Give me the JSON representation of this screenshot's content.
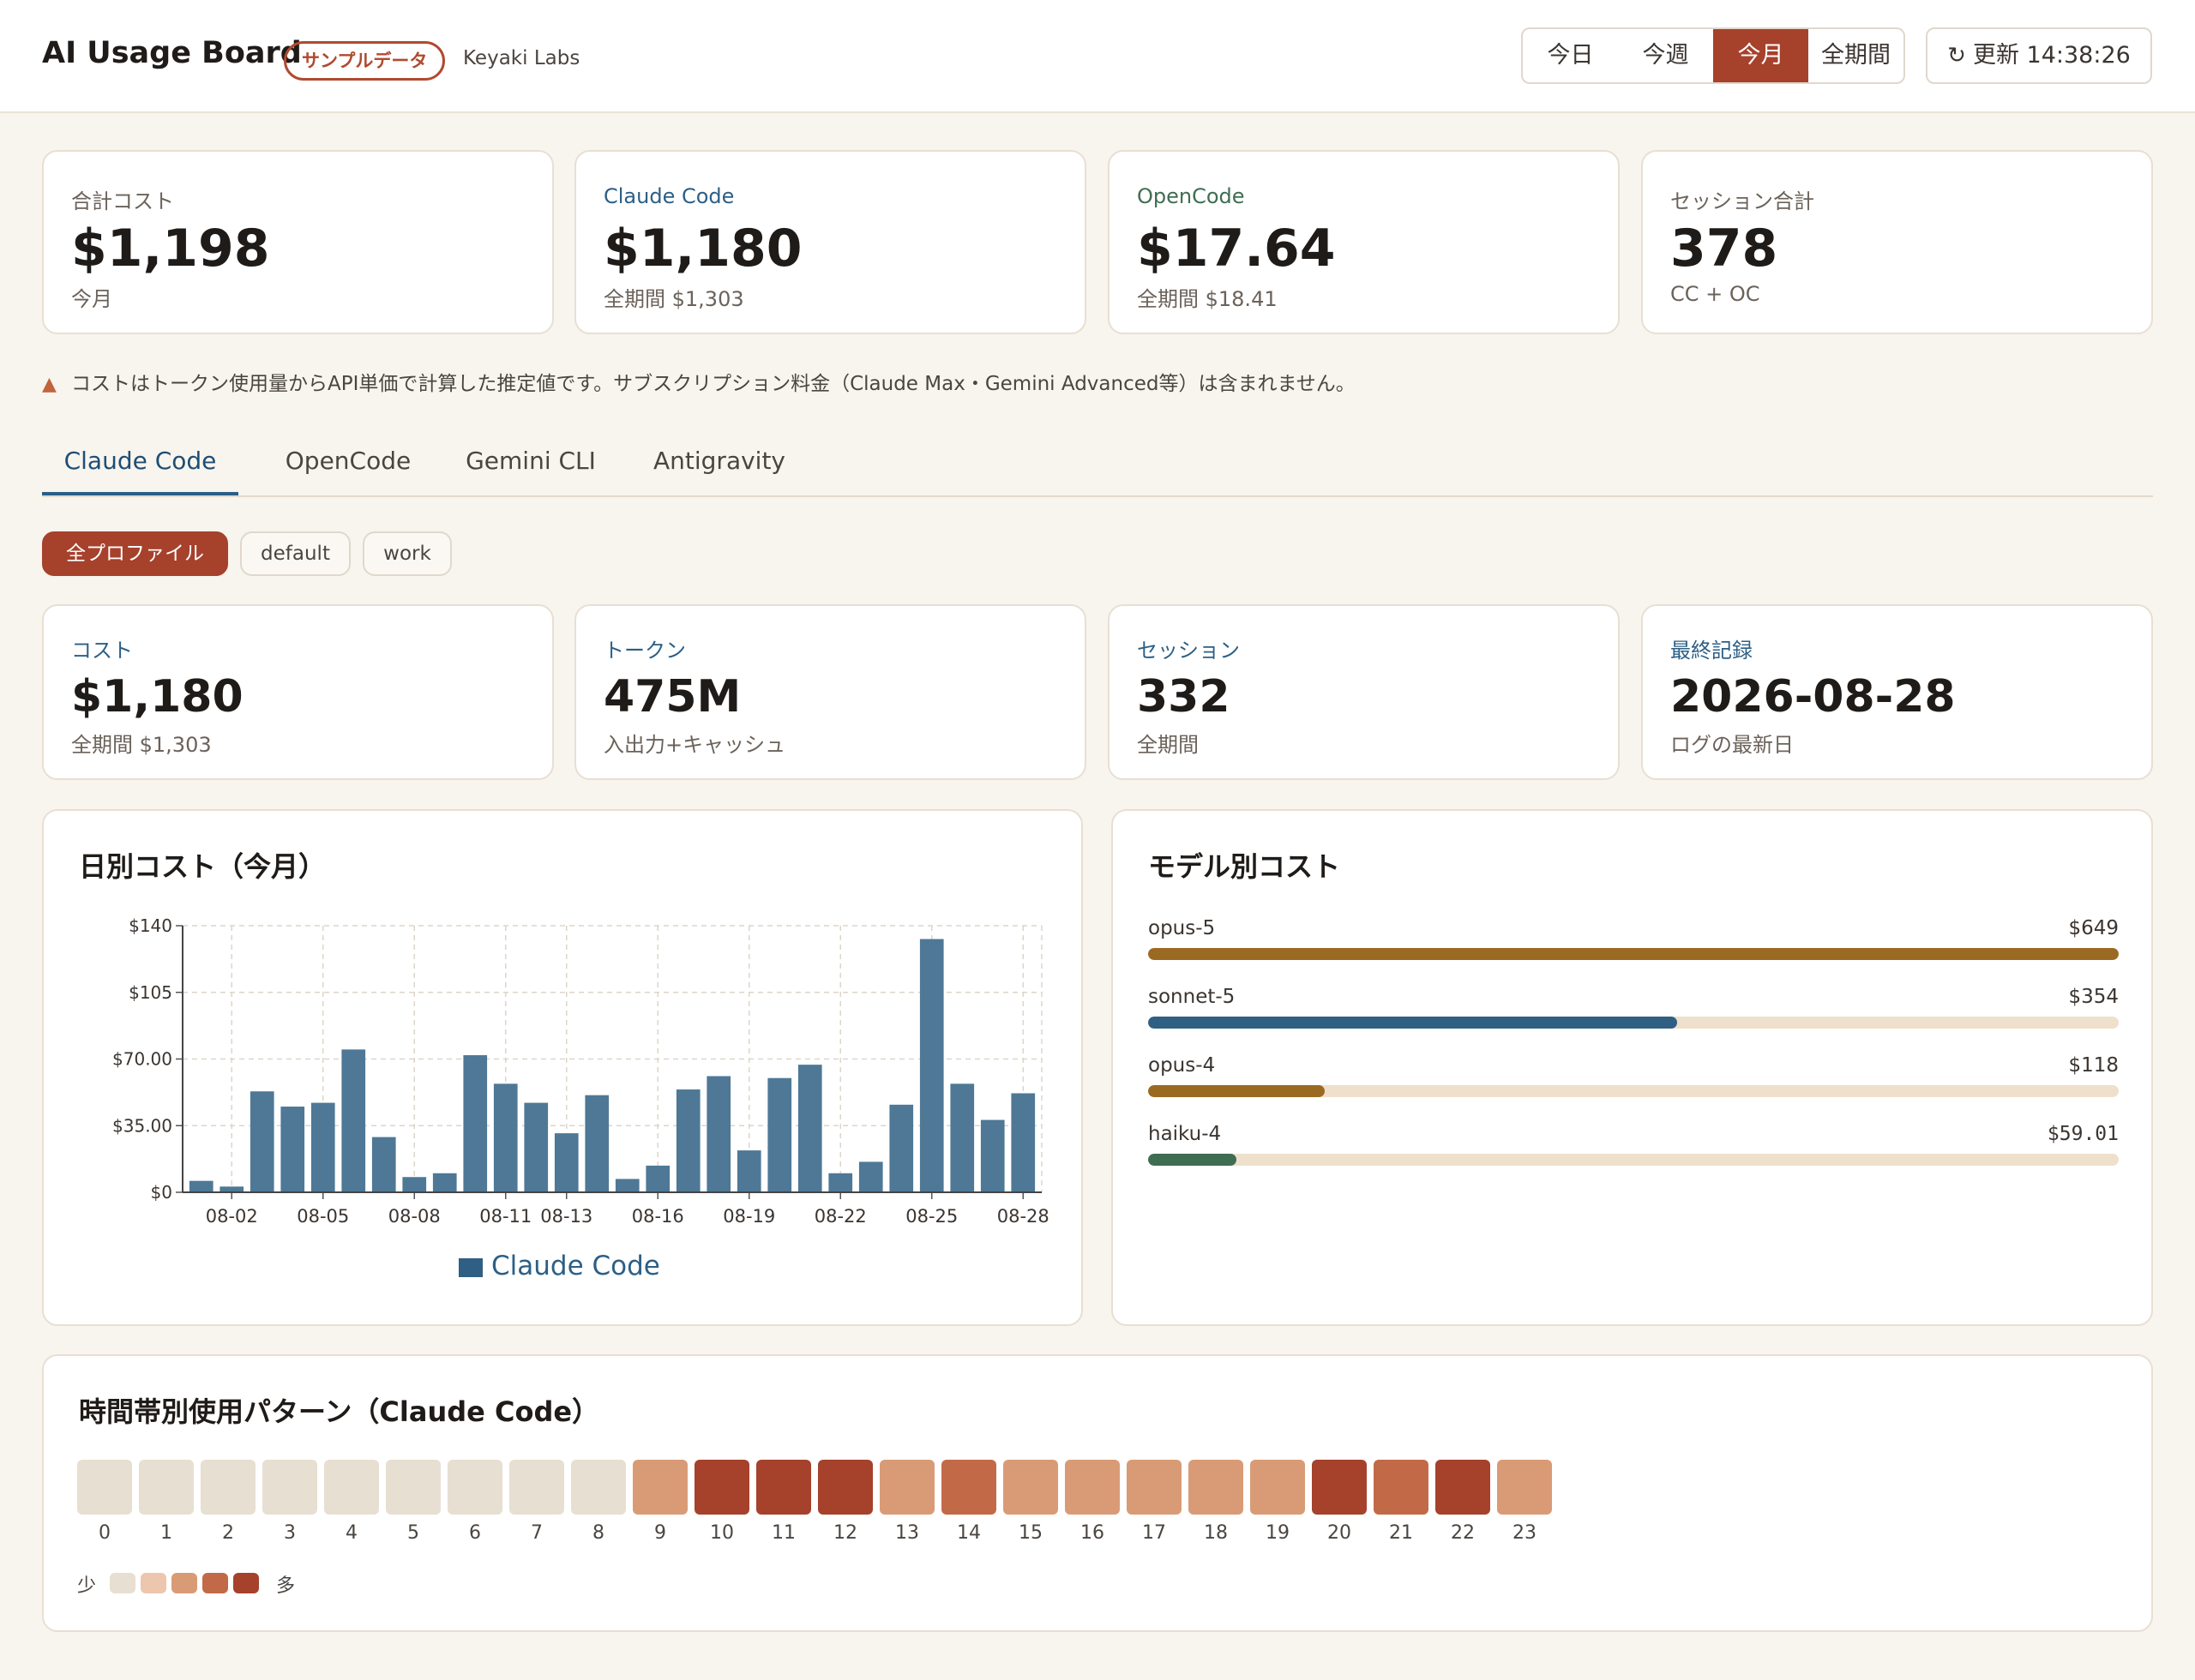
{
  "header": {
    "title": "AI Usage Board",
    "badge": "サンプルデータ",
    "org": "Keyaki Labs",
    "ranges": [
      "今日",
      "今週",
      "今月",
      "全期間"
    ],
    "active_range": "今月",
    "refresh_label": "更新 14:38:26"
  },
  "summary": [
    {
      "label": "合計コスト",
      "value": "$1,198",
      "sub": "今月"
    },
    {
      "label": "Claude Code",
      "value": "$1,180",
      "sub": "全期間 $1,303"
    },
    {
      "label": "OpenCode",
      "value": "$17.64",
      "sub": "全期間 $18.41"
    },
    {
      "label": "セッション合計",
      "value": "378",
      "sub": "CC + OC"
    }
  ],
  "notice": "コストはトークン使用量からAPI単価で計算した推定値です。サブスクリプション料金（Claude Max・Gemini Advanced等）は含まれません。",
  "tabs": [
    "Claude Code",
    "OpenCode",
    "Gemini CLI",
    "Antigravity"
  ],
  "active_tab": "Claude Code",
  "profiles": [
    "全プロファイル",
    "default",
    "work"
  ],
  "active_profile": "全プロファイル",
  "detail_stats": [
    {
      "label": "コスト",
      "value": "$1,180",
      "sub": "全期間 $1,303"
    },
    {
      "label": "トークン",
      "value": "475M",
      "sub": "入出力+キャッシュ"
    },
    {
      "label": "セッション",
      "value": "332",
      "sub": "全期間"
    },
    {
      "label": "最終記録",
      "value": "2026-08-28",
      "sub": "ログの最新日"
    }
  ],
  "daily_panel_title": "日別コスト（今月）",
  "model_panel_title": "モデル別コスト",
  "hourly_panel_title": "時間帯別使用パターン（Claude Code）",
  "chart_data": {
    "type": "bar",
    "title": "日別コスト（今月）",
    "categories": [
      "08-01",
      "08-02",
      "08-03",
      "08-04",
      "08-05",
      "08-06",
      "08-07",
      "08-08",
      "08-09",
      "08-10",
      "08-11",
      "08-12",
      "08-13",
      "08-14",
      "08-15",
      "08-16",
      "08-17",
      "08-18",
      "08-19",
      "08-20",
      "08-21",
      "08-22",
      "08-23",
      "08-24",
      "08-25",
      "08-26",
      "08-27",
      "08-28"
    ],
    "tick_labels": [
      "08-02",
      "08-05",
      "08-08",
      "08-11",
      "08-13",
      "08-16",
      "08-19",
      "08-22",
      "08-25",
      "08-28"
    ],
    "series": [
      {
        "name": "Claude Code",
        "values": [
          6,
          3,
          53,
          45,
          47,
          75,
          29,
          8,
          10,
          72,
          57,
          47,
          31,
          51,
          7,
          14,
          54,
          61,
          22,
          60,
          67,
          10,
          16,
          46,
          133,
          57,
          38,
          52
        ]
      }
    ],
    "yticks": [
      "$0",
      "$35.00",
      "$70.00",
      "$105",
      "$140"
    ],
    "ylim": [
      0,
      140
    ],
    "grid": true,
    "legend": "bottom",
    "color": "#4e7896"
  },
  "models": [
    {
      "name": "opus-5",
      "cost": "$649",
      "value": 649,
      "color": "#9a6a22"
    },
    {
      "name": "sonnet-5",
      "cost": "$354",
      "value": 354,
      "color": "#2f5f83"
    },
    {
      "name": "opus-4",
      "cost": "$118",
      "value": 118,
      "color": "#9a6a22"
    },
    {
      "name": "haiku-4",
      "cost": "$59.01",
      "value": 59.01,
      "color": "#3f6d52"
    }
  ],
  "hourly": {
    "hours": [
      "0",
      "1",
      "2",
      "3",
      "4",
      "5",
      "6",
      "7",
      "8",
      "9",
      "10",
      "11",
      "12",
      "13",
      "14",
      "15",
      "16",
      "17",
      "18",
      "19",
      "20",
      "21",
      "22",
      "23"
    ],
    "levels": [
      0,
      0,
      0,
      0,
      0,
      0,
      0,
      0,
      0,
      2,
      4,
      4,
      4,
      2,
      3,
      2,
      2,
      2,
      2,
      2,
      4,
      3,
      4,
      2
    ],
    "palette": [
      "#e7dfd1",
      "#ecc6ad",
      "#d99b76",
      "#c26a47",
      "#a6412c"
    ],
    "legend_low": "少",
    "legend_high": "多"
  }
}
